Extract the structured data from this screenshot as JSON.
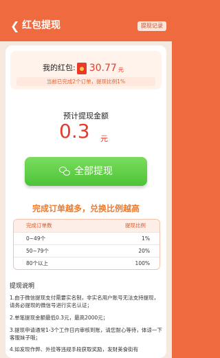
{
  "header": {
    "title": "红包提现",
    "record_label": "提现记录"
  },
  "balance": {
    "label": "我的红包:",
    "amount": "30.77",
    "unit": "元",
    "progress_note": "当前已完成2个订单，提现比例1%"
  },
  "withdraw": {
    "estimate_label": "预计提现金额",
    "estimate_amount": "0.3",
    "estimate_unit": "元",
    "button_label": "全部提现"
  },
  "ratio": {
    "heading": "完成订单越多，兑换比例越高",
    "columns": [
      "完成订单数",
      "提现比例"
    ],
    "rows": [
      [
        "0~49个",
        "1%"
      ],
      [
        "50~79个",
        "20%"
      ],
      [
        "80个以上",
        "100%"
      ]
    ]
  },
  "notes": {
    "title": "提现说明",
    "items": [
      "1.由于微信提现支付需要实名制，非实名用户账号无法支持提现，请务必提现的微信号进行实名认证；",
      "2.单笔提现金额最低0.3元，最高2000元；",
      "3.提现申请通常1-3个工作日内审核到账，请您耐心等待，体谅一下客服妹子哦；",
      "4.如发现作弊、外挂等违规手段获取奖励，发财美食街有"
    ]
  },
  "colors": {
    "brand": "#ef6a3f",
    "accent_red": "#e63a2a",
    "button_green": "#4cc437"
  }
}
